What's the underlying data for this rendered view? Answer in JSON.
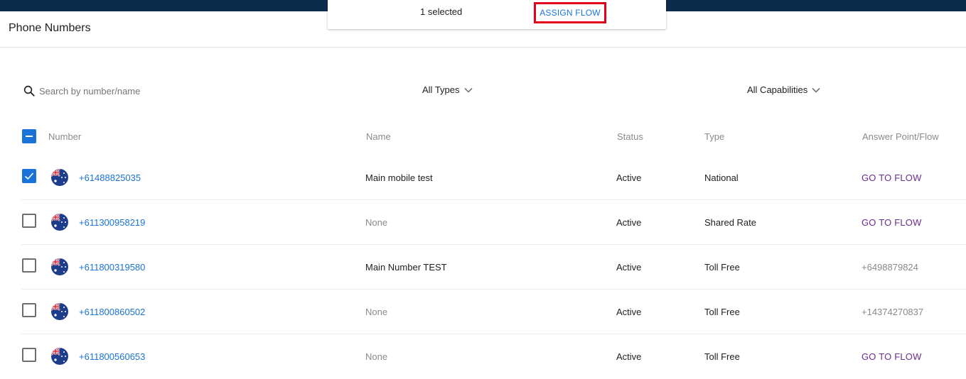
{
  "selection_bar": {
    "count_text": "1 selected",
    "assign_label": "ASSIGN FLOW"
  },
  "page": {
    "title": "Phone Numbers"
  },
  "search": {
    "placeholder": "Search by number/name"
  },
  "filters": {
    "types": "All Types",
    "capabilities": "All Capabilities"
  },
  "columns": {
    "number": "Number",
    "name": "Name",
    "status": "Status",
    "type": "Type",
    "answer_point": "Answer Point/Flow"
  },
  "rows": [
    {
      "checked": true,
      "number": "+61488825035",
      "name": "Main mobile test",
      "name_is_none": false,
      "status": "Active",
      "type": "National",
      "answer": "GO TO FLOW",
      "answer_is_link": true
    },
    {
      "checked": false,
      "number": "+611300958219",
      "name": "None",
      "name_is_none": true,
      "status": "Active",
      "type": "Shared Rate",
      "answer": "GO TO FLOW",
      "answer_is_link": true
    },
    {
      "checked": false,
      "number": "+611800319580",
      "name": "Main Number TEST",
      "name_is_none": false,
      "status": "Active",
      "type": "Toll Free",
      "answer": "+6498879824",
      "answer_is_link": false
    },
    {
      "checked": false,
      "number": "+611800860502",
      "name": "None",
      "name_is_none": true,
      "status": "Active",
      "type": "Toll Free",
      "answer": "+14374270837",
      "answer_is_link": false
    },
    {
      "checked": false,
      "number": "+611800560653",
      "name": "None",
      "name_is_none": true,
      "status": "Active",
      "type": "Toll Free",
      "answer": "GO TO FLOW",
      "answer_is_link": true
    }
  ],
  "icons": {
    "search": "search-icon",
    "chevron": "chevron-down-icon",
    "flag": "australia-flag-icon",
    "check": "check-icon"
  },
  "colors": {
    "topbar": "#0b2d4b",
    "accent": "#1a73d9",
    "flow_link": "#6b2d8f",
    "highlight": "#e3001b"
  }
}
